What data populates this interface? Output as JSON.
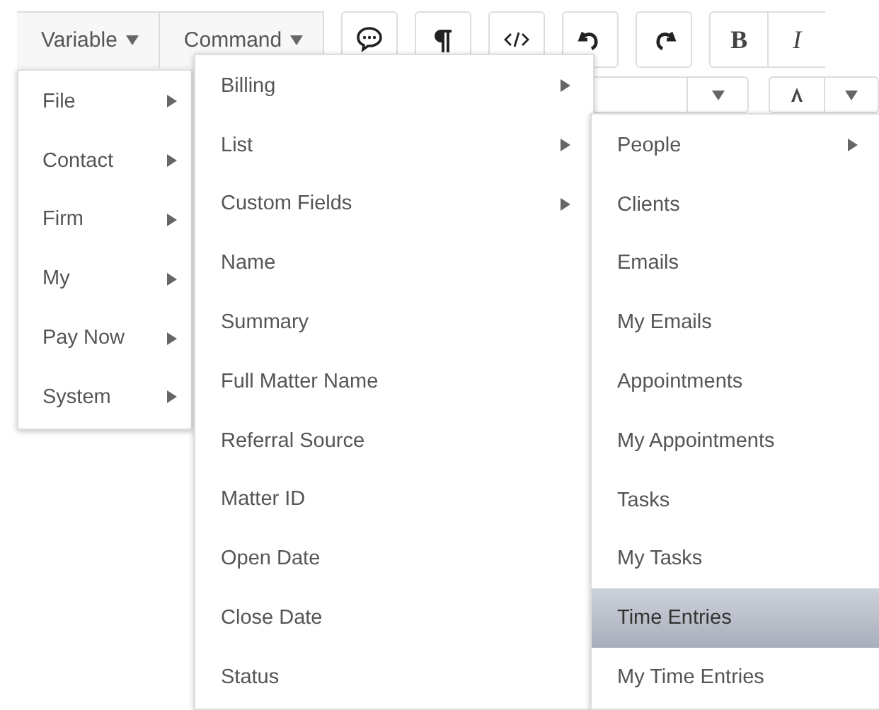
{
  "toolbar": {
    "menus": [
      {
        "label": "Variable"
      },
      {
        "label": "Command"
      }
    ],
    "format_buttons": [
      "B",
      "I"
    ]
  },
  "variable_menu": {
    "items": [
      {
        "label": "File",
        "has_submenu": true
      },
      {
        "label": "Contact",
        "has_submenu": true
      },
      {
        "label": "Firm",
        "has_submenu": true
      },
      {
        "label": "My",
        "has_submenu": true
      },
      {
        "label": "Pay Now",
        "has_submenu": true
      },
      {
        "label": "System",
        "has_submenu": true
      }
    ]
  },
  "command_menu": {
    "items": [
      {
        "label": "Billing",
        "has_submenu": true
      },
      {
        "label": "List",
        "has_submenu": true
      },
      {
        "label": "Custom Fields",
        "has_submenu": true
      },
      {
        "label": "Name",
        "has_submenu": false
      },
      {
        "label": "Summary",
        "has_submenu": false
      },
      {
        "label": "Full Matter Name",
        "has_submenu": false
      },
      {
        "label": "Referral Source",
        "has_submenu": false
      },
      {
        "label": "Matter ID",
        "has_submenu": false
      },
      {
        "label": "Open Date",
        "has_submenu": false
      },
      {
        "label": "Close Date",
        "has_submenu": false
      },
      {
        "label": "Status",
        "has_submenu": false
      }
    ]
  },
  "list_submenu": {
    "items": [
      {
        "label": "People",
        "has_submenu": true,
        "selected": false
      },
      {
        "label": "Clients",
        "has_submenu": false,
        "selected": false
      },
      {
        "label": "Emails",
        "has_submenu": false,
        "selected": false
      },
      {
        "label": "My Emails",
        "has_submenu": false,
        "selected": false
      },
      {
        "label": "Appointments",
        "has_submenu": false,
        "selected": false
      },
      {
        "label": "My Appointments",
        "has_submenu": false,
        "selected": false
      },
      {
        "label": "Tasks",
        "has_submenu": false,
        "selected": false
      },
      {
        "label": "My Tasks",
        "has_submenu": false,
        "selected": false
      },
      {
        "label": "Time Entries",
        "has_submenu": false,
        "selected": true
      },
      {
        "label": "My Time Entries",
        "has_submenu": false,
        "selected": false
      }
    ]
  }
}
